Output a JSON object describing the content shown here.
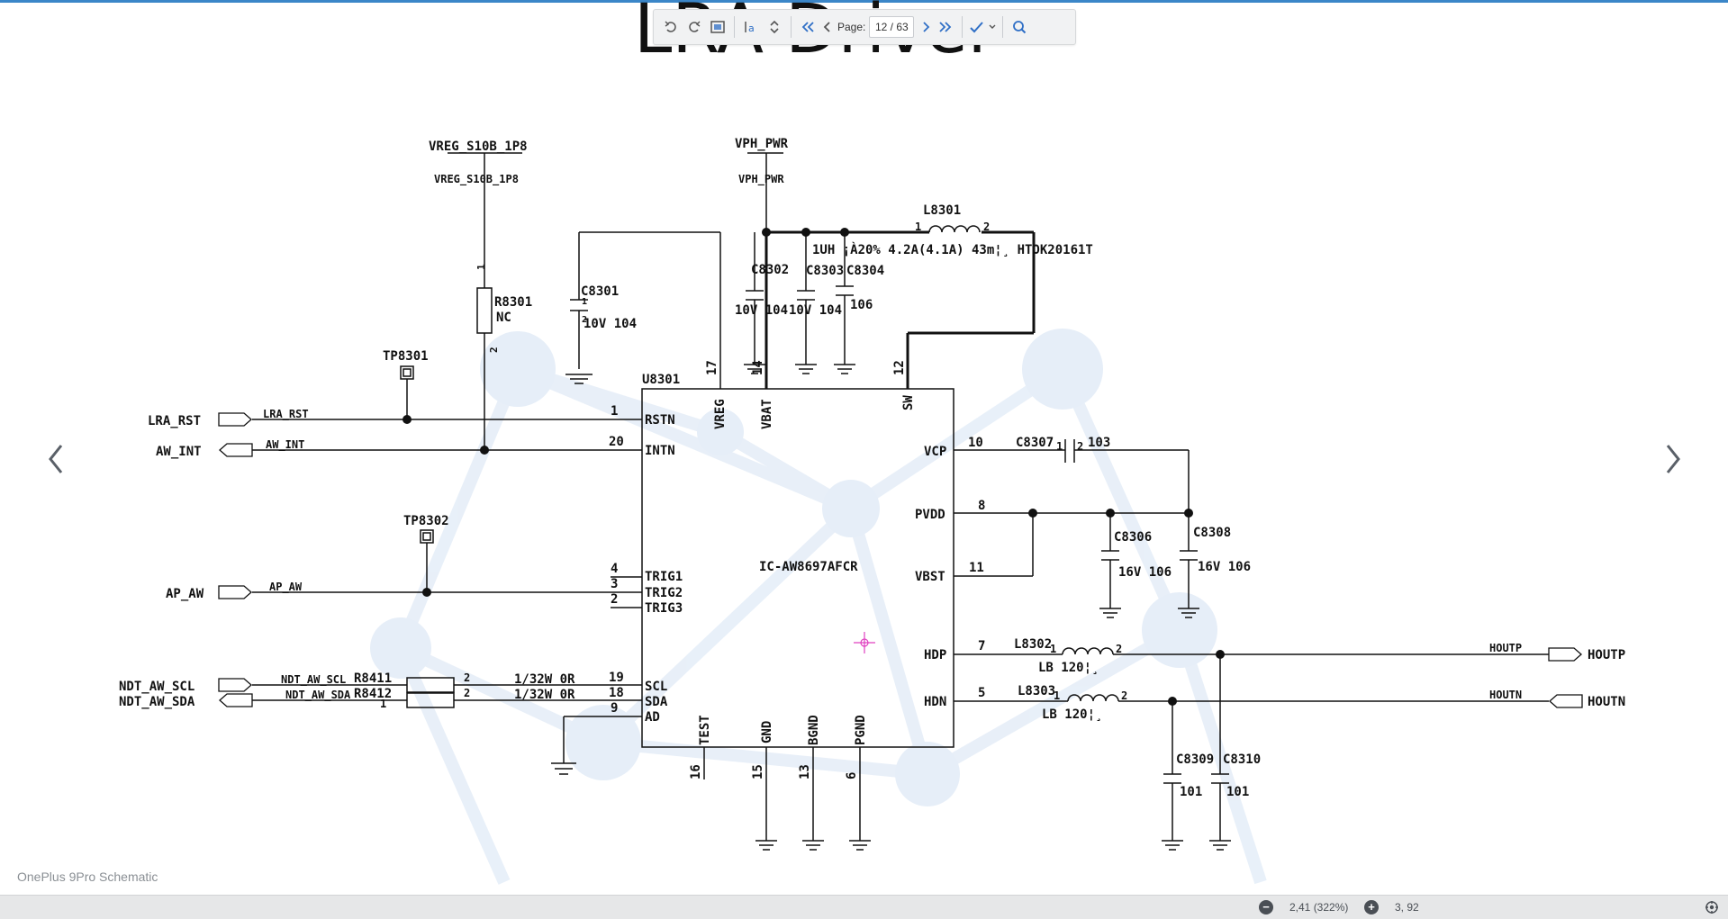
{
  "title": "LRA Driver",
  "toolbar": {
    "rotate_ccw_icon": "rotate-left-icon",
    "rotate_cw_icon": "rotate-right-icon",
    "fit_icon": "fit-page-icon",
    "text_select_icon": "text-select-icon",
    "page_label": "Page:",
    "page_value": "12 / 63"
  },
  "schematic": {
    "vreg_rail": "VREG_S10B_1P8",
    "vreg_rail_net": "VREG_S10B_1P8",
    "vph_rail": "VPH_PWR",
    "vph_rail_net": "VPH_PWR",
    "l8301": {
      "ref": "L8301",
      "pin1": "1",
      "pin2": "2",
      "spec": "1UH ¡À20% 4.2A(4.1A) 43m¦¸ HTOK20161T"
    },
    "c8301": {
      "ref": "C8301",
      "value": "10V 104"
    },
    "c8302": {
      "ref": "C8302",
      "value": "10V 104"
    },
    "c8303": {
      "ref": "C8303",
      "value": "10V 104"
    },
    "c8304": {
      "ref": "C8304",
      "value": "106"
    },
    "r8301": {
      "ref": "R8301",
      "value": "NC",
      "pin1": "1",
      "pin2": "2"
    },
    "tp8301": "TP8301",
    "tp8302": "TP8302",
    "u8301": "U8301",
    "ic": "IC-AW8697AFCR",
    "ports_left": [
      {
        "name": "LRA_RST",
        "net": "LRA_RST"
      },
      {
        "name": "AW_INT",
        "net": "AW_INT"
      },
      {
        "name": "AP_AW",
        "net": "AP_AW"
      },
      {
        "name": "NDT_AW_SCL",
        "net": "NDT_AW_SCL"
      },
      {
        "name": "NDT_AW_SDA",
        "net": "NDT_AW_SDA"
      }
    ],
    "r8411": {
      "ref": "R8411",
      "value": "1/32W 0R",
      "pin1": "1",
      "pin2": "2"
    },
    "r8412": {
      "ref": "R8412",
      "value": "1/32W 0R",
      "pin1": "1",
      "pin2": "2"
    },
    "pins_left": [
      {
        "num": "1",
        "name": "RSTN"
      },
      {
        "num": "20",
        "name": "INTN"
      },
      {
        "num": "4",
        "name": "TRIG1"
      },
      {
        "num": "3",
        "name": "TRIG2"
      },
      {
        "num": "2",
        "name": "TRIG3"
      },
      {
        "num": "19",
        "name": "SCL"
      },
      {
        "num": "18",
        "name": "SDA"
      },
      {
        "num": "9",
        "name": "AD"
      }
    ],
    "pins_top": [
      {
        "num": "17",
        "name": "VREG"
      },
      {
        "num": "14",
        "name": "VBAT"
      },
      {
        "num": "12",
        "name": "SW"
      }
    ],
    "pins_right": [
      {
        "num": "10",
        "name": "VCP"
      },
      {
        "num": "8",
        "name": "PVDD"
      },
      {
        "num": "11",
        "name": "VBST"
      },
      {
        "num": "7",
        "name": "HDP"
      },
      {
        "num": "5",
        "name": "HDN"
      }
    ],
    "pins_bottom": [
      {
        "num": "16",
        "name": "TEST"
      },
      {
        "num": "15",
        "name": "GND"
      },
      {
        "num": "13",
        "name": "BGND"
      },
      {
        "num": "6",
        "name": "PGND"
      }
    ],
    "c8307": {
      "ref": "C8307",
      "value": "103",
      "pin1": "1",
      "pin2": "2"
    },
    "c8306": {
      "ref": "C8306",
      "value": "16V 106"
    },
    "c8308": {
      "ref": "C8308",
      "value": "16V 106"
    },
    "l8302": {
      "ref": "L8302",
      "value": "LB 120¦¸",
      "pin1": "1",
      "pin2": "2"
    },
    "l8303": {
      "ref": "L8303",
      "value": "LB 120¦¸",
      "pin1": "1",
      "pin2": "2"
    },
    "c8309": {
      "ref": "C8309",
      "value": "101"
    },
    "c8310": {
      "ref": "C8310",
      "value": "101"
    },
    "ports_right": [
      {
        "name": "HOUTP",
        "net": "HOUTP"
      },
      {
        "name": "HOUTN",
        "net": "HOUTN"
      }
    ],
    "cap_pin1": "1",
    "cap_pin2": "2"
  },
  "document_name": "OnePlus 9Pro Schematic",
  "status": {
    "zoom": "2,41 (322%)",
    "coords": "3, 92"
  }
}
